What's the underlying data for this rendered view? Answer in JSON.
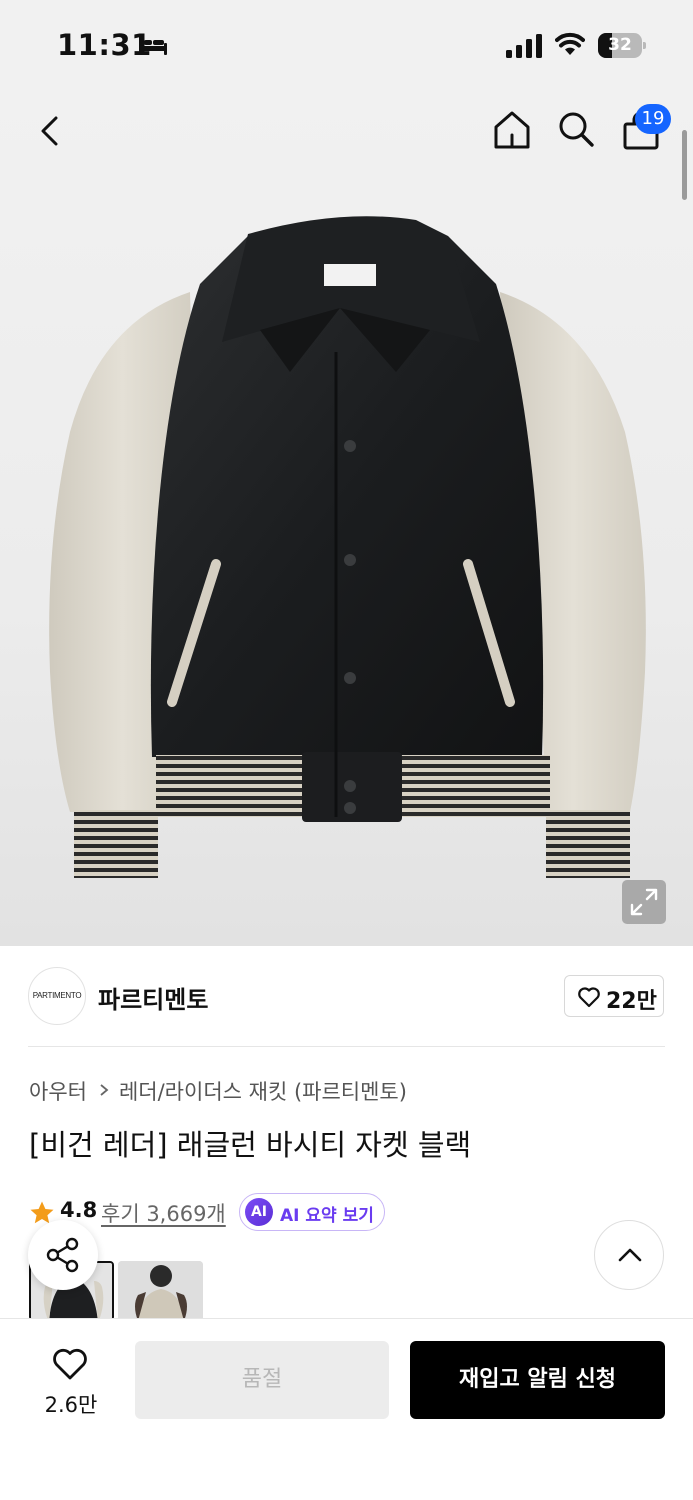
{
  "status_bar": {
    "time": "11:31",
    "battery_level": "32",
    "battery_fraction": 0.32,
    "icons": [
      "bed-icon",
      "signal-icon",
      "wifi-icon",
      "battery-icon"
    ]
  },
  "header": {
    "cart_count": "19",
    "icons": [
      "back-icon",
      "home-icon",
      "search-icon",
      "cart-icon",
      "expand-icon"
    ]
  },
  "brand": {
    "logo_text": "PARTIMENTO",
    "name": "파르티멘토",
    "like_count": "22만"
  },
  "product": {
    "breadcrumb": {
      "category": "아우터",
      "subcategory": "레더/라이더스 재킷 (파르티멘토)"
    },
    "title": "[비건 레더] 래글런 바시티 자켓 블랙",
    "rating": "4.8",
    "review_link": "후기 3,669개",
    "ai_badge": "AI",
    "ai_summary_label": "AI 요약 보기"
  },
  "bottom_bar": {
    "wish_count": "2.6만",
    "soldout_label": "품절",
    "restock_label": "재입고 알림 신청"
  },
  "colors": {
    "accent_blue": "#1565ff",
    "ai_purple": "#6a3cf0",
    "star_orange": "#f39c1a",
    "cta_black": "#000000"
  }
}
